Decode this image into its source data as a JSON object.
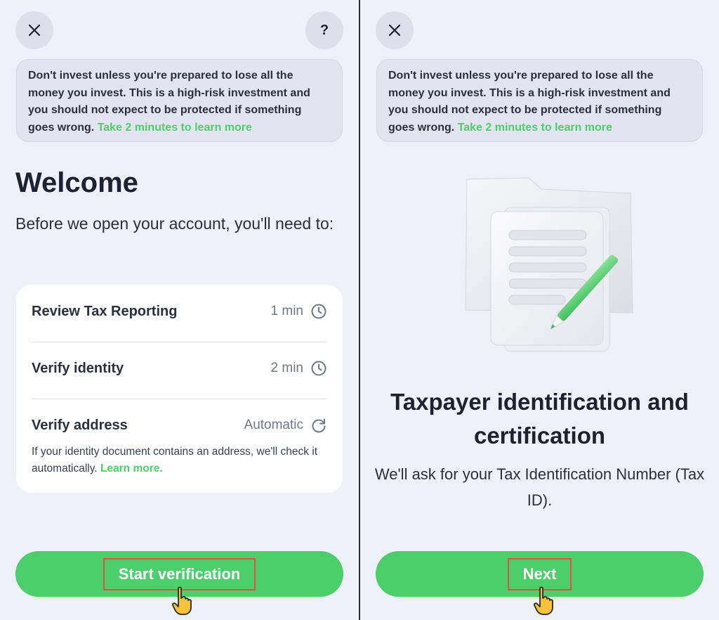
{
  "left": {
    "warning": {
      "text": "Don't invest unless you're prepared to lose all the money you invest. This is a high-risk investment and you should not expect to be protected if something goes wrong.",
      "link": "Take 2 minutes to learn more"
    },
    "title": "Welcome",
    "subtitle": "Before we open your account, you'll need to:",
    "steps": [
      {
        "label": "Review Tax Reporting",
        "value": "1 min",
        "icon": "clock-icon"
      },
      {
        "label": "Verify identity",
        "value": "2 min",
        "icon": "clock-icon"
      },
      {
        "label": "Verify address",
        "value": "Automatic",
        "icon": "refresh-icon"
      }
    ],
    "address_note": "If your identity document contains an address, we'll check it automatically.",
    "address_note_link": "Learn more.",
    "cta_label": "Start verification"
  },
  "right": {
    "warning": {
      "text": "Don't invest unless you're prepared to lose all the money you invest. This is a high-risk investment and you should not expect to be protected if something goes wrong.",
      "link": "Take 2 minutes to learn more"
    },
    "title": "Taxpayer identification and certification",
    "subtitle": "We'll ask for your Tax Identification Number (Tax ID).",
    "cta_label": "Next"
  },
  "colors": {
    "accent_green": "#4ccf6a",
    "background": "#eef0fa",
    "highlight_box": "#e0533f"
  }
}
